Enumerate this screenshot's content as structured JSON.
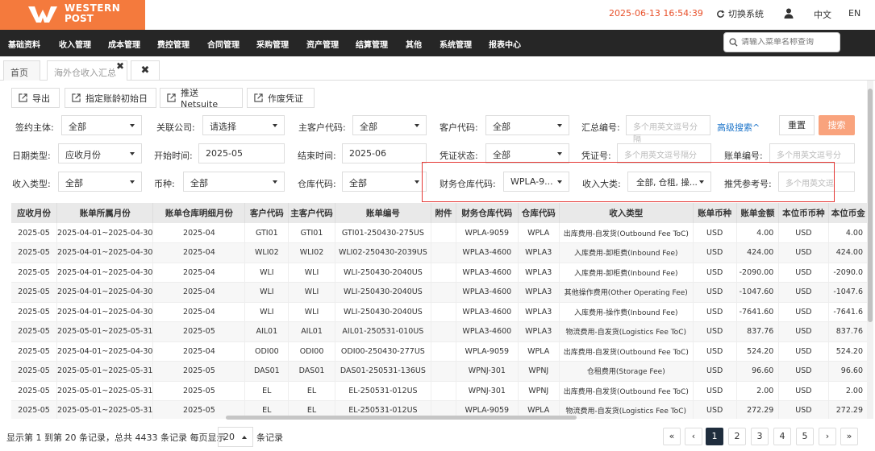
{
  "brand": {
    "line1": "WESTERN",
    "line2": "POST",
    "color": "#f47a3d"
  },
  "header": {
    "datetime": "2025-06-13 16:54:39",
    "switch_label": "切换系统",
    "lang_zh": "中文",
    "lang_en": "EN"
  },
  "nav": {
    "items": [
      "基础资料",
      "收入管理",
      "成本管理",
      "费控管理",
      "合同管理",
      "采购管理",
      "资产管理",
      "结算管理",
      "其他",
      "系统管理",
      "报表中心"
    ],
    "search_placeholder": "请输入菜单名称查询"
  },
  "tabs": {
    "home": "首页",
    "active": "海外仓收入汇总"
  },
  "toolbar": {
    "export": "导出",
    "set_initial": "指定账龄初始日",
    "push_netsuite": "推送Netsuite",
    "void_voucher": "作废凭证"
  },
  "filters": {
    "sign_entity": {
      "label": "签约主体:",
      "value": "全部"
    },
    "related_company": {
      "label": "关联公司:",
      "value": "请选择"
    },
    "main_customer_code": {
      "label": "主客户代码:",
      "value": "全部"
    },
    "customer_code": {
      "label": "客户代码:",
      "value": "全部"
    },
    "summary_no": {
      "label": "汇总编号:",
      "placeholder": "多个用英文逗号分隔"
    },
    "advanced_search": "高级搜索^",
    "reset": "重置",
    "search": "搜索",
    "date_type": {
      "label": "日期类型:",
      "value": "应收月份"
    },
    "start_time": {
      "label": "开始时间:",
      "value": "2025-05"
    },
    "end_time": {
      "label": "结束时间:",
      "value": "2025-06"
    },
    "voucher_status": {
      "label": "凭证状态:",
      "value": "全部"
    },
    "voucher_no": {
      "label": "凭证号:",
      "placeholder": "多个用英文逗号隔分"
    },
    "bill_no": {
      "label": "账单编号:",
      "placeholder": "多个用英文逗号分"
    },
    "income_type": {
      "label": "收入类型:",
      "value": "全部"
    },
    "currency": {
      "label": "币种:",
      "value": "全部"
    },
    "warehouse_code": {
      "label": "仓库代码:",
      "value": "全部"
    },
    "finance_warehouse_code": {
      "label": "财务仓库代码:",
      "value": "WPLA-9..."
    },
    "income_category": {
      "label": "收入大类:",
      "value": "全部, 仓租, 操..."
    },
    "push_ref_no": {
      "label": "推凭参考号:",
      "placeholder": "多个用英文逗"
    }
  },
  "table": {
    "columns": [
      "应收月份",
      "账单所属月份",
      "账单仓库明细月份",
      "客户代码",
      "主客户代码",
      "账单编号",
      "附件",
      "财务仓库代码",
      "仓库代码",
      "收入类型",
      "账单币种",
      "账单金额",
      "本位币币种",
      "本位币金"
    ],
    "rows": [
      [
        "2025-05",
        "2025-04-01~2025-04-30",
        "2025-04",
        "GTI01",
        "GTI01",
        "GTI01-250430-275US",
        "",
        "WPLA-9059",
        "WPLA",
        "出库费用-自发货(Outbound Fee ToC)",
        "USD",
        "4.00",
        "USD",
        "4.00"
      ],
      [
        "2025-05",
        "2025-04-01~2025-04-30",
        "2025-04",
        "WLI02",
        "WLI02",
        "WLI02-250430-2039US",
        "",
        "WPLA3-4600",
        "WPLA3",
        "入库费用-卸柜费(Inbound Fee)",
        "USD",
        "424.00",
        "USD",
        "424.00"
      ],
      [
        "2025-05",
        "2025-04-01~2025-04-30",
        "2025-04",
        "WLI",
        "WLI",
        "WLI-250430-2040US",
        "",
        "WPLA3-4600",
        "WPLA3",
        "入库费用-卸柜费(Inbound Fee)",
        "USD",
        "-2090.00",
        "USD",
        "-2090.0"
      ],
      [
        "2025-05",
        "2025-04-01~2025-04-30",
        "2025-04",
        "WLI",
        "WLI",
        "WLI-250430-2040US",
        "",
        "WPLA3-4600",
        "WPLA3",
        "其他操作费用(Other Operating Fee)",
        "USD",
        "-1047.60",
        "USD",
        "-1047.6"
      ],
      [
        "2025-05",
        "2025-04-01~2025-04-30",
        "2025-04",
        "WLI",
        "WLI",
        "WLI-250430-2040US",
        "",
        "WPLA3-4600",
        "WPLA3",
        "入库费用-操作费(Inbound Fee)",
        "USD",
        "-7641.60",
        "USD",
        "-7641.6"
      ],
      [
        "2025-05",
        "2025-05-01~2025-05-31",
        "2025-05",
        "AIL01",
        "AIL01",
        "AIL01-250531-010US",
        "",
        "WPLA3-4600",
        "WPLA3",
        "物流费用-自发货(Logistics Fee ToC)",
        "USD",
        "837.76",
        "USD",
        "837.76"
      ],
      [
        "2025-05",
        "2025-04-01~2025-04-30",
        "2025-04",
        "ODI00",
        "ODI00",
        "ODI00-250430-277US",
        "",
        "WPLA-9059",
        "WPLA",
        "出库费用-自发货(Outbound Fee ToC)",
        "USD",
        "524.20",
        "USD",
        "524.20"
      ],
      [
        "2025-05",
        "2025-05-01~2025-05-31",
        "2025-05",
        "DAS01",
        "DAS01",
        "DAS01-250531-136US",
        "",
        "WPNJ-301",
        "WPNJ",
        "仓租费用(Storage Fee)",
        "USD",
        "96.60",
        "USD",
        "96.60"
      ],
      [
        "2025-05",
        "2025-05-01~2025-05-31",
        "2025-05",
        "EL",
        "EL",
        "EL-250531-012US",
        "",
        "WPNJ-301",
        "WPNJ",
        "出库费用-自发货(Outbound Fee ToC)",
        "USD",
        "2.00",
        "USD",
        "2.00"
      ],
      [
        "2025-05",
        "2025-05-01~2025-05-31",
        "2025-05",
        "EL",
        "EL",
        "EL-250531-012US",
        "",
        "WPLA-9059",
        "WPLA",
        "物流费用-自发货(Logistics Fee ToC)",
        "USD",
        "272.29",
        "USD",
        "272.29"
      ]
    ]
  },
  "footer": {
    "info": "显示第 1 到第 20 条记录，总共 4433 条记录 每页显示",
    "page_size": "20",
    "records_suffix": "条记录"
  },
  "pagination": {
    "first": "«",
    "prev": "‹",
    "pages": [
      "1",
      "2",
      "3",
      "4",
      "5"
    ],
    "current": "1",
    "next": "›",
    "last": "»"
  }
}
